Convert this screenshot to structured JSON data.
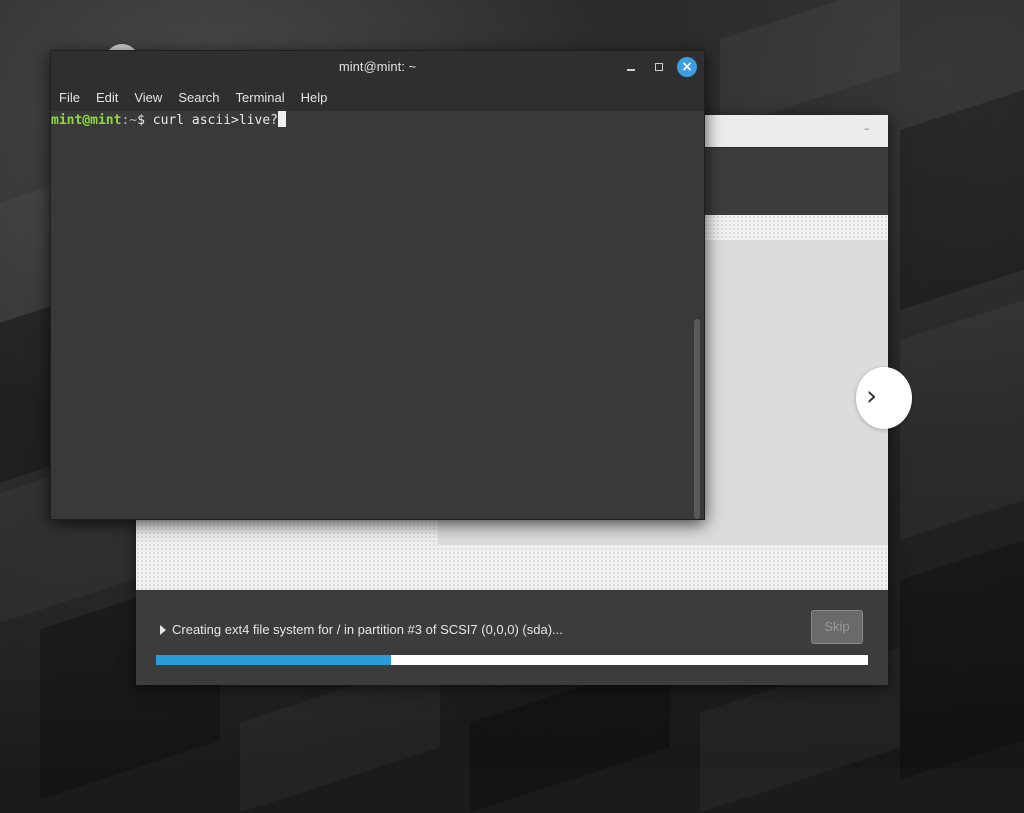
{
  "terminal": {
    "title": "mint@mint: ~",
    "menu": [
      "File",
      "Edit",
      "View",
      "Search",
      "Terminal",
      "Help"
    ],
    "prompt_user": "mint@mint",
    "prompt_sep": ":",
    "prompt_path": "~",
    "prompt_symbol": "$ ",
    "command": "curl ascii>live?",
    "buttons": {
      "minimize": "minimize",
      "maximize": "maximize",
      "close": "×"
    }
  },
  "installer": {
    "status_text": "Creating ext4 file system for / in partition #3 of SCSI7 (0,0,0) (sda)...",
    "skip_label": "Skip",
    "progress_percent": 33,
    "next_icon": "›",
    "minimize_icon": "–"
  },
  "colors": {
    "accent": "#2d9bd8",
    "mint_green": "#87cf3e",
    "prompt_green": "#8bdc3a"
  },
  "icons": {
    "desktop_icon": "circle-icon",
    "expander": "triangle-right-icon",
    "next": "chevron-right-icon"
  }
}
